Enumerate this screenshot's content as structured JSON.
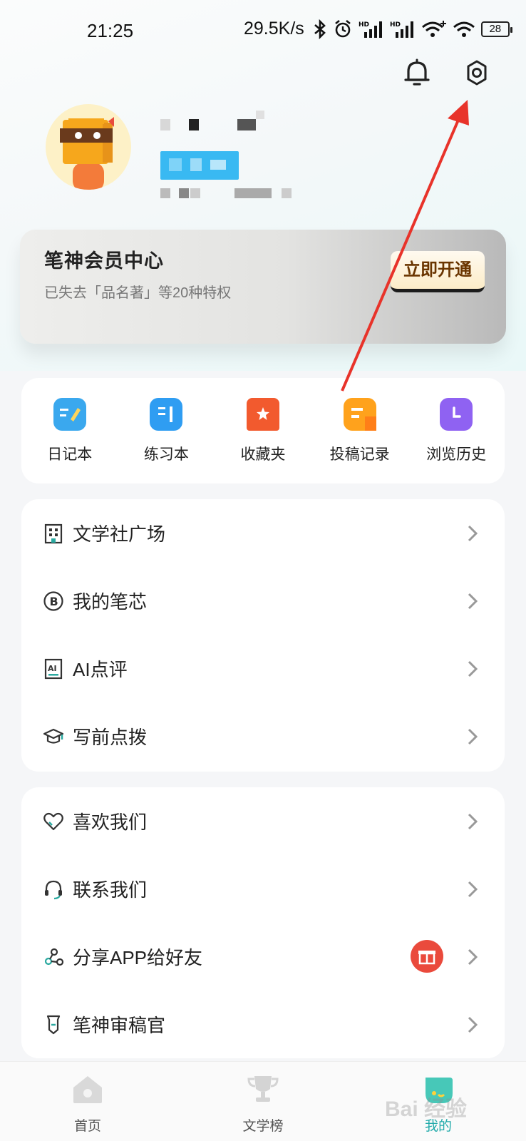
{
  "status": {
    "time": "21:25",
    "speed": "29.5K/s",
    "battery": "28"
  },
  "vip": {
    "title": "笔神会员中心",
    "subtitle": "已失去「品名著」等20种特权",
    "button": "立即开通"
  },
  "quick": [
    {
      "label": "日记本",
      "icon": "diary-icon",
      "color": "#3aa8ee"
    },
    {
      "label": "练习本",
      "icon": "practice-book-icon",
      "color": "#2f9df2"
    },
    {
      "label": "收藏夹",
      "icon": "favorites-icon",
      "color": "#f25a2e"
    },
    {
      "label": "投稿记录",
      "icon": "submission-record-icon",
      "color": "#ffa21c"
    },
    {
      "label": "浏览历史",
      "icon": "history-clock-icon",
      "color": "#8f62f2"
    }
  ],
  "menu1": [
    {
      "label": "文学社广场",
      "icon": "building-icon"
    },
    {
      "label": "我的笔芯",
      "icon": "coin-b-icon"
    },
    {
      "label": "AI点评",
      "icon": "ai-review-icon"
    },
    {
      "label": "写前点拨",
      "icon": "graduation-cap-icon"
    }
  ],
  "menu2": [
    {
      "label": "喜欢我们",
      "icon": "heart-icon"
    },
    {
      "label": "联系我们",
      "icon": "headset-icon"
    },
    {
      "label": "分享APP给好友",
      "icon": "share-icon"
    },
    {
      "label": "笔神审稿官",
      "icon": "reviewer-badge-icon"
    }
  ],
  "tabs": [
    {
      "label": "首页",
      "icon": "home-icon"
    },
    {
      "label": "文学榜",
      "icon": "trophy-icon"
    },
    {
      "label": "我的",
      "icon": "profile-icon"
    }
  ],
  "watermark": "Bai 经验"
}
